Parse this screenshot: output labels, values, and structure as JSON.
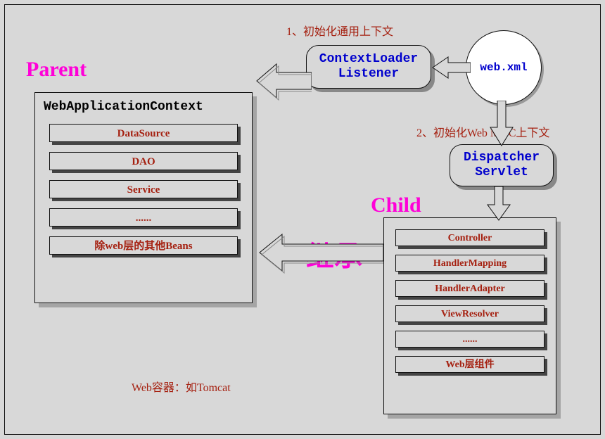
{
  "titles": {
    "parent": "Parent",
    "child": "Child"
  },
  "parent": {
    "ctx_title": "WebApplicationContext",
    "items": [
      "DataSource",
      "DAO",
      "Service",
      "......",
      "除web层的其他Beans"
    ]
  },
  "child": {
    "items": [
      "Controller",
      "HandlerMapping",
      "HandlerAdapter",
      "ViewResolver",
      "......",
      "Web层组件"
    ]
  },
  "nodes": {
    "listener_l1": "ContextLoader",
    "listener_l2": "Listener",
    "dispatcher_l1": "Dispatcher",
    "dispatcher_l2": "Servlet",
    "webxml": "web.xml"
  },
  "annotations": {
    "step1": "1、初始化通用上下文",
    "step2": "2、初始化Web MVC上下文",
    "tomcat": "Web容器：如Tomcat",
    "inherit": "继承"
  }
}
